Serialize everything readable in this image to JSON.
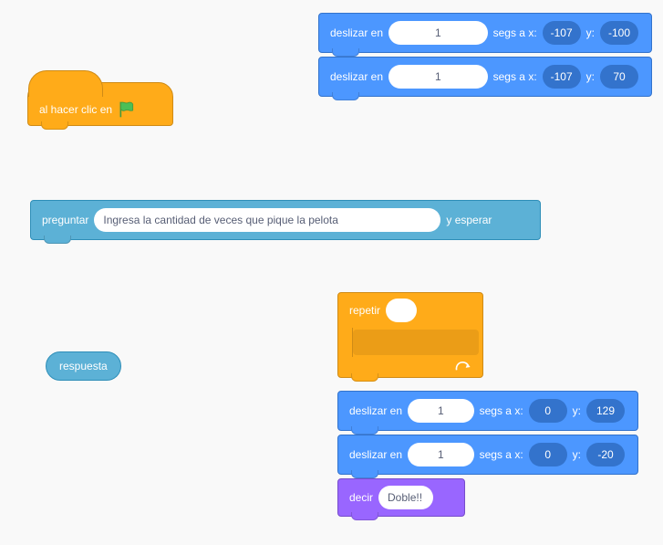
{
  "colors": {
    "motion": "#4c97ff",
    "events": "#ffab19",
    "control": "#ffab19",
    "sensing": "#5cb1d6",
    "looks": "#9966ff"
  },
  "hat": {
    "label": "al hacer clic en"
  },
  "glide1": {
    "prefix": "deslizar en",
    "secs": "1",
    "mid": "segs a x:",
    "x": "-107",
    "ylabel": "y:",
    "y": "-100"
  },
  "glide2": {
    "prefix": "deslizar en",
    "secs": "1",
    "mid": "segs a x:",
    "x": "-107",
    "ylabel": "y:",
    "y": "70"
  },
  "ask": {
    "prefix": "preguntar",
    "question": "Ingresa la cantidad de veces que pique la pelota",
    "suffix": "y esperar"
  },
  "answer": {
    "label": "respuesta"
  },
  "repeat": {
    "label": "repetir"
  },
  "glide3": {
    "prefix": "deslizar en",
    "secs": "1",
    "mid": "segs a x:",
    "x": "0",
    "ylabel": "y:",
    "y": "129"
  },
  "glide4": {
    "prefix": "deslizar en",
    "secs": "1",
    "mid": "segs a x:",
    "x": "0",
    "ylabel": "y:",
    "y": "-20"
  },
  "say": {
    "prefix": "decir",
    "text": "Doble!!"
  }
}
